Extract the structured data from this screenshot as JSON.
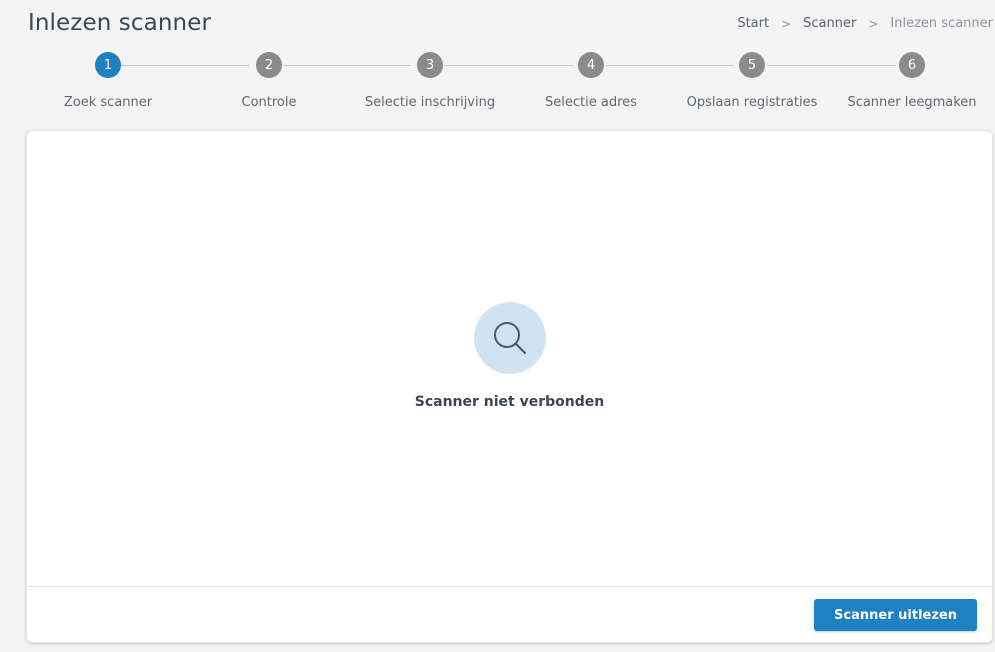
{
  "header": {
    "title": "Inlezen scanner",
    "breadcrumb": [
      "Start",
      "Scanner",
      "Inlezen scanner"
    ],
    "breadcrumb_separator": ">"
  },
  "stepper": {
    "active_step": 1,
    "steps": [
      {
        "number": "1",
        "label": "Zoek scanner"
      },
      {
        "number": "2",
        "label": "Controle"
      },
      {
        "number": "3",
        "label": "Selectie inschrijving"
      },
      {
        "number": "4",
        "label": "Selectie adres"
      },
      {
        "number": "5",
        "label": "Opslaan registraties"
      },
      {
        "number": "6",
        "label": "Scanner leegmaken"
      }
    ]
  },
  "main": {
    "empty_state_icon": "search-icon",
    "empty_state_message": "Scanner niet verbonden",
    "action_button_label": "Scanner uitlezen"
  },
  "colors": {
    "primary": "#1e82c2",
    "step_inactive": "#8b8b8b",
    "icon_bg": "#cfe3f1",
    "icon_stroke": "#4a5b6b"
  }
}
